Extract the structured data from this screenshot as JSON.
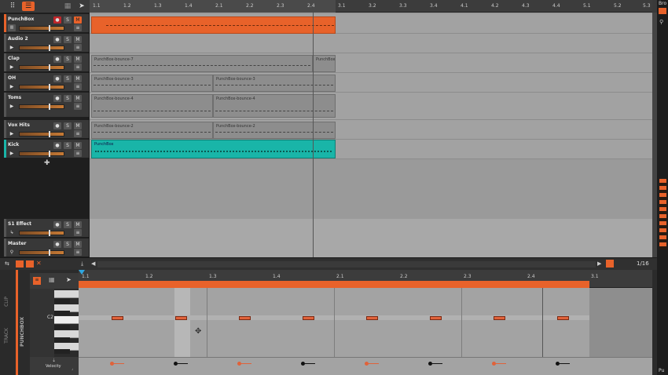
{
  "arranger": {
    "ruler_ticks": [
      "1.1",
      "1.2",
      "1.3",
      "1.4",
      "2.1",
      "2.2",
      "2.3",
      "2.4",
      "3.1",
      "3.2",
      "3.3",
      "3.4",
      "4.1",
      "4.2",
      "4.3",
      "4.4",
      "5.1",
      "5.2",
      "5.3"
    ],
    "tracks": [
      {
        "name": "PunchBox",
        "color": "#e8622a"
      },
      {
        "name": "Audio 2",
        "color": "#555555"
      },
      {
        "name": "Clap",
        "color": "#555555"
      },
      {
        "name": "OH",
        "color": "#555555"
      },
      {
        "name": "Toms",
        "color": "#555555"
      },
      {
        "name": "Vox Hits",
        "color": "#555555"
      },
      {
        "name": "Kick",
        "color": "#19b5a8"
      }
    ],
    "fx_tracks": [
      {
        "name": "S1 Effect"
      },
      {
        "name": "Master"
      }
    ],
    "clips": {
      "clap1": "PunchBox-bounce-7",
      "clap2": "PunchBox",
      "oh1": "PunchBox-bounce-3",
      "oh2": "PunchBox-bounce-3",
      "toms1": "PunchBox-bounce-4",
      "toms2": "PunchBox-bounce-4",
      "vox1": "PunchBox-bounce-2",
      "vox2": "PunchBox-bounce-2",
      "kick": "PunchBox"
    },
    "button_labels": {
      "solo": "S",
      "mute": "M"
    }
  },
  "bottom_bar": {
    "zoom": "1/16"
  },
  "editor": {
    "side_labels": {
      "clip": "CLIP",
      "punchbox": "PUNCHBOX",
      "track": "TRACK"
    },
    "ruler_ticks": [
      "1.1",
      "1.2",
      "1.3",
      "1.4",
      "2.1",
      "2.2",
      "2.3",
      "2.4",
      "3.1"
    ],
    "key_label": "C2",
    "velocity_label": "Velocity",
    "notes": [
      {
        "beat": 1
      },
      {
        "beat": 2
      },
      {
        "beat": 3
      },
      {
        "beat": 4
      },
      {
        "beat": 5
      },
      {
        "beat": 6
      },
      {
        "beat": 7
      },
      {
        "beat": 8
      }
    ]
  },
  "right_panel": {
    "browser_label": "Bro",
    "bottom_label": "Pu"
  },
  "colors": {
    "accent": "#e8622a",
    "teal": "#19b5a8"
  }
}
